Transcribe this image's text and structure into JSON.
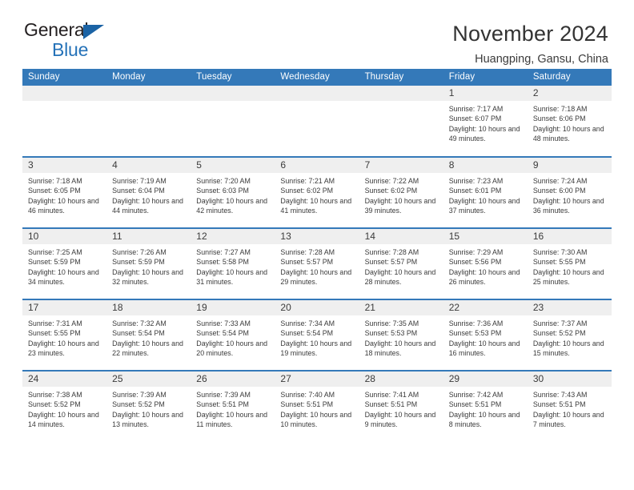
{
  "brand": {
    "name_part1": "General",
    "name_part2": "Blue",
    "triangle_color": "#1b63a5",
    "blue_color": "#2572b8"
  },
  "header": {
    "title": "November 2024",
    "subtitle": "Huangping, Gansu, China"
  },
  "theme": {
    "header_blue": "#3479b9",
    "daynum_band": "#efefef",
    "text": "#3b3b3b"
  },
  "weekdays": [
    "Sunday",
    "Monday",
    "Tuesday",
    "Wednesday",
    "Thursday",
    "Friday",
    "Saturday"
  ],
  "weeks": [
    [
      {
        "day": "",
        "details": ""
      },
      {
        "day": "",
        "details": ""
      },
      {
        "day": "",
        "details": ""
      },
      {
        "day": "",
        "details": ""
      },
      {
        "day": "",
        "details": ""
      },
      {
        "day": "1",
        "details": "Sunrise: 7:17 AM\nSunset: 6:07 PM\nDaylight: 10 hours and 49 minutes."
      },
      {
        "day": "2",
        "details": "Sunrise: 7:18 AM\nSunset: 6:06 PM\nDaylight: 10 hours and 48 minutes."
      }
    ],
    [
      {
        "day": "3",
        "details": "Sunrise: 7:18 AM\nSunset: 6:05 PM\nDaylight: 10 hours and 46 minutes."
      },
      {
        "day": "4",
        "details": "Sunrise: 7:19 AM\nSunset: 6:04 PM\nDaylight: 10 hours and 44 minutes."
      },
      {
        "day": "5",
        "details": "Sunrise: 7:20 AM\nSunset: 6:03 PM\nDaylight: 10 hours and 42 minutes."
      },
      {
        "day": "6",
        "details": "Sunrise: 7:21 AM\nSunset: 6:02 PM\nDaylight: 10 hours and 41 minutes."
      },
      {
        "day": "7",
        "details": "Sunrise: 7:22 AM\nSunset: 6:02 PM\nDaylight: 10 hours and 39 minutes."
      },
      {
        "day": "8",
        "details": "Sunrise: 7:23 AM\nSunset: 6:01 PM\nDaylight: 10 hours and 37 minutes."
      },
      {
        "day": "9",
        "details": "Sunrise: 7:24 AM\nSunset: 6:00 PM\nDaylight: 10 hours and 36 minutes."
      }
    ],
    [
      {
        "day": "10",
        "details": "Sunrise: 7:25 AM\nSunset: 5:59 PM\nDaylight: 10 hours and 34 minutes."
      },
      {
        "day": "11",
        "details": "Sunrise: 7:26 AM\nSunset: 5:59 PM\nDaylight: 10 hours and 32 minutes."
      },
      {
        "day": "12",
        "details": "Sunrise: 7:27 AM\nSunset: 5:58 PM\nDaylight: 10 hours and 31 minutes."
      },
      {
        "day": "13",
        "details": "Sunrise: 7:28 AM\nSunset: 5:57 PM\nDaylight: 10 hours and 29 minutes."
      },
      {
        "day": "14",
        "details": "Sunrise: 7:28 AM\nSunset: 5:57 PM\nDaylight: 10 hours and 28 minutes."
      },
      {
        "day": "15",
        "details": "Sunrise: 7:29 AM\nSunset: 5:56 PM\nDaylight: 10 hours and 26 minutes."
      },
      {
        "day": "16",
        "details": "Sunrise: 7:30 AM\nSunset: 5:55 PM\nDaylight: 10 hours and 25 minutes."
      }
    ],
    [
      {
        "day": "17",
        "details": "Sunrise: 7:31 AM\nSunset: 5:55 PM\nDaylight: 10 hours and 23 minutes."
      },
      {
        "day": "18",
        "details": "Sunrise: 7:32 AM\nSunset: 5:54 PM\nDaylight: 10 hours and 22 minutes."
      },
      {
        "day": "19",
        "details": "Sunrise: 7:33 AM\nSunset: 5:54 PM\nDaylight: 10 hours and 20 minutes."
      },
      {
        "day": "20",
        "details": "Sunrise: 7:34 AM\nSunset: 5:54 PM\nDaylight: 10 hours and 19 minutes."
      },
      {
        "day": "21",
        "details": "Sunrise: 7:35 AM\nSunset: 5:53 PM\nDaylight: 10 hours and 18 minutes."
      },
      {
        "day": "22",
        "details": "Sunrise: 7:36 AM\nSunset: 5:53 PM\nDaylight: 10 hours and 16 minutes."
      },
      {
        "day": "23",
        "details": "Sunrise: 7:37 AM\nSunset: 5:52 PM\nDaylight: 10 hours and 15 minutes."
      }
    ],
    [
      {
        "day": "24",
        "details": "Sunrise: 7:38 AM\nSunset: 5:52 PM\nDaylight: 10 hours and 14 minutes."
      },
      {
        "day": "25",
        "details": "Sunrise: 7:39 AM\nSunset: 5:52 PM\nDaylight: 10 hours and 13 minutes."
      },
      {
        "day": "26",
        "details": "Sunrise: 7:39 AM\nSunset: 5:51 PM\nDaylight: 10 hours and 11 minutes."
      },
      {
        "day": "27",
        "details": "Sunrise: 7:40 AM\nSunset: 5:51 PM\nDaylight: 10 hours and 10 minutes."
      },
      {
        "day": "28",
        "details": "Sunrise: 7:41 AM\nSunset: 5:51 PM\nDaylight: 10 hours and 9 minutes."
      },
      {
        "day": "29",
        "details": "Sunrise: 7:42 AM\nSunset: 5:51 PM\nDaylight: 10 hours and 8 minutes."
      },
      {
        "day": "30",
        "details": "Sunrise: 7:43 AM\nSunset: 5:51 PM\nDaylight: 10 hours and 7 minutes."
      }
    ]
  ]
}
